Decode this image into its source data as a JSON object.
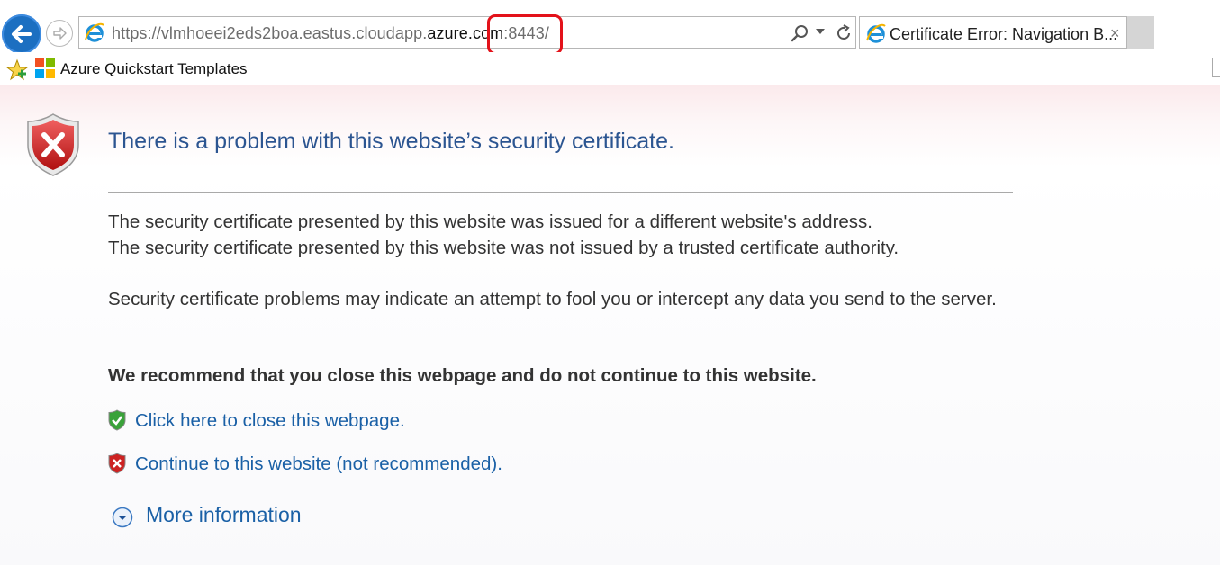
{
  "browser": {
    "address": {
      "url_prefix": "https://vlmhoeei2eds2boa.eastus.cloudapp.",
      "url_domain": "azure.com",
      "url_suffix": ":8443/"
    },
    "tab": {
      "title": "Certificate Error: Navigation B...",
      "close_glyph": "×"
    },
    "favorites": {
      "item_label": "Azure Quickstart Templates"
    },
    "icons": [
      "back-icon",
      "forward-icon",
      "ie-logo-icon",
      "search-icon",
      "dropdown-icon",
      "refresh-icon",
      "favorites-star-icon",
      "microsoft-logo-icon"
    ],
    "accent_colors": {
      "highlight_box": "#e3121a",
      "back_button": "#1c6fc1"
    }
  },
  "page": {
    "title": "There is a problem with this website’s security certificate.",
    "para1_line1": "The security certificate presented by this website was issued for a different website's address.",
    "para1_line2": "The security certificate presented by this website was not issued by a trusted certificate authority.",
    "para2": "Security certificate problems may indicate an attempt to fool you or intercept any data you send to the server.",
    "recommendation": "We recommend that you close this webpage and do not continue to this website.",
    "close_link": "Click here to close this webpage.",
    "continue_link": "Continue to this website (not recommended).",
    "more_info": "More information",
    "colors": {
      "title": "#2c5591",
      "link": "#1a60a6",
      "text": "#333333"
    }
  }
}
